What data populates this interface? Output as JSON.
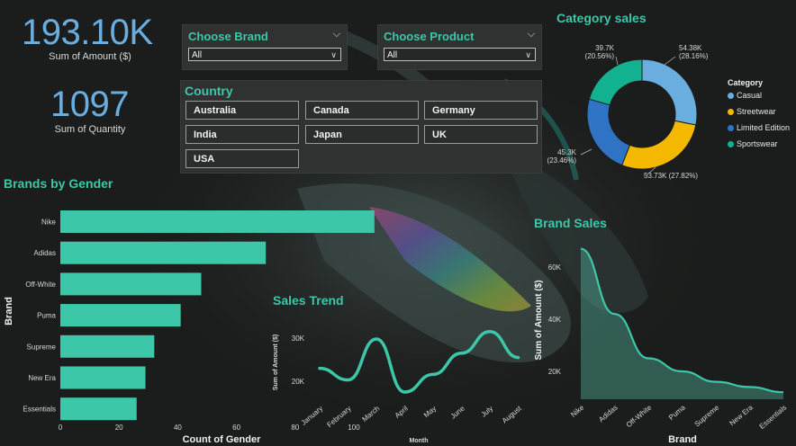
{
  "kpis": {
    "amount_value": "193.10K",
    "amount_label": "Sum of Amount ($)",
    "quantity_value": "1097",
    "quantity_label": "Sum of Quantity"
  },
  "filters": {
    "brand": {
      "title": "Choose Brand",
      "value": "All"
    },
    "product": {
      "title": "Choose Product",
      "value": "All"
    },
    "country": {
      "title": "Country",
      "options": [
        "Australia",
        "Canada",
        "Germany",
        "India",
        "Japan",
        "UK",
        "USA"
      ]
    }
  },
  "colors": {
    "accent": "#3cc7a8",
    "kpi": "#6aaee0",
    "casual": "#6aaee0",
    "streetwear": "#f5b800",
    "limited_edition": "#2f73c4",
    "sportswear": "#12b18f",
    "area": "#5fd0b6"
  },
  "icons": {
    "dropdown": "chevron-down-icon"
  },
  "chart_data": [
    {
      "id": "brands_by_gender",
      "type": "bar",
      "orientation": "horizontal",
      "title": "Brands by Gender",
      "xlabel": "Count of Gender",
      "ylabel": "Brand",
      "categories": [
        "Nike",
        "Adidas",
        "Off-White",
        "Puma",
        "Supreme",
        "New Era",
        "Essentials"
      ],
      "values": [
        107,
        70,
        48,
        41,
        32,
        29,
        26
      ],
      "xticks": [
        "0",
        "20",
        "40",
        "60",
        "80",
        "100"
      ],
      "xlim": [
        0,
        107
      ]
    },
    {
      "id": "sales_trend",
      "type": "line",
      "title": "Sales Trend",
      "xlabel": "Month",
      "ylabel": "Sum of Amount ($)",
      "categories": [
        "January",
        "February",
        "March",
        "April",
        "May",
        "June",
        "July",
        "August"
      ],
      "values": [
        23000,
        20300,
        29800,
        17500,
        21600,
        26500,
        31500,
        25500
      ],
      "yticks": [
        "20K",
        "30K"
      ],
      "ylim": [
        15000,
        34000
      ]
    },
    {
      "id": "brand_sales",
      "type": "area",
      "title": "Brand Sales",
      "xlabel": "Brand",
      "ylabel": "Sum of Amount ($)",
      "categories": [
        "Nike",
        "Adidas",
        "Off-White",
        "Puma",
        "Supreme",
        "New Era",
        "Essentials"
      ],
      "values": [
        67000,
        42000,
        25000,
        20000,
        16000,
        14000,
        12000
      ],
      "yticks": [
        "20K",
        "40K",
        "60K"
      ],
      "ylim": [
        10000,
        70000
      ]
    },
    {
      "id": "category_sales",
      "type": "pie",
      "title": "Category sales",
      "legend_title": "Category",
      "legend_position": "right",
      "categories": [
        "Casual",
        "Streetwear",
        "Limited Edition",
        "Sportswear"
      ],
      "values": [
        54.38,
        53.73,
        45.3,
        39.7
      ],
      "labels": [
        "54.38K\n(28.16%)",
        "53.73K (27.82%)",
        "45.3K\n(23.46%)",
        "39.7K\n(20.56%)"
      ]
    }
  ]
}
